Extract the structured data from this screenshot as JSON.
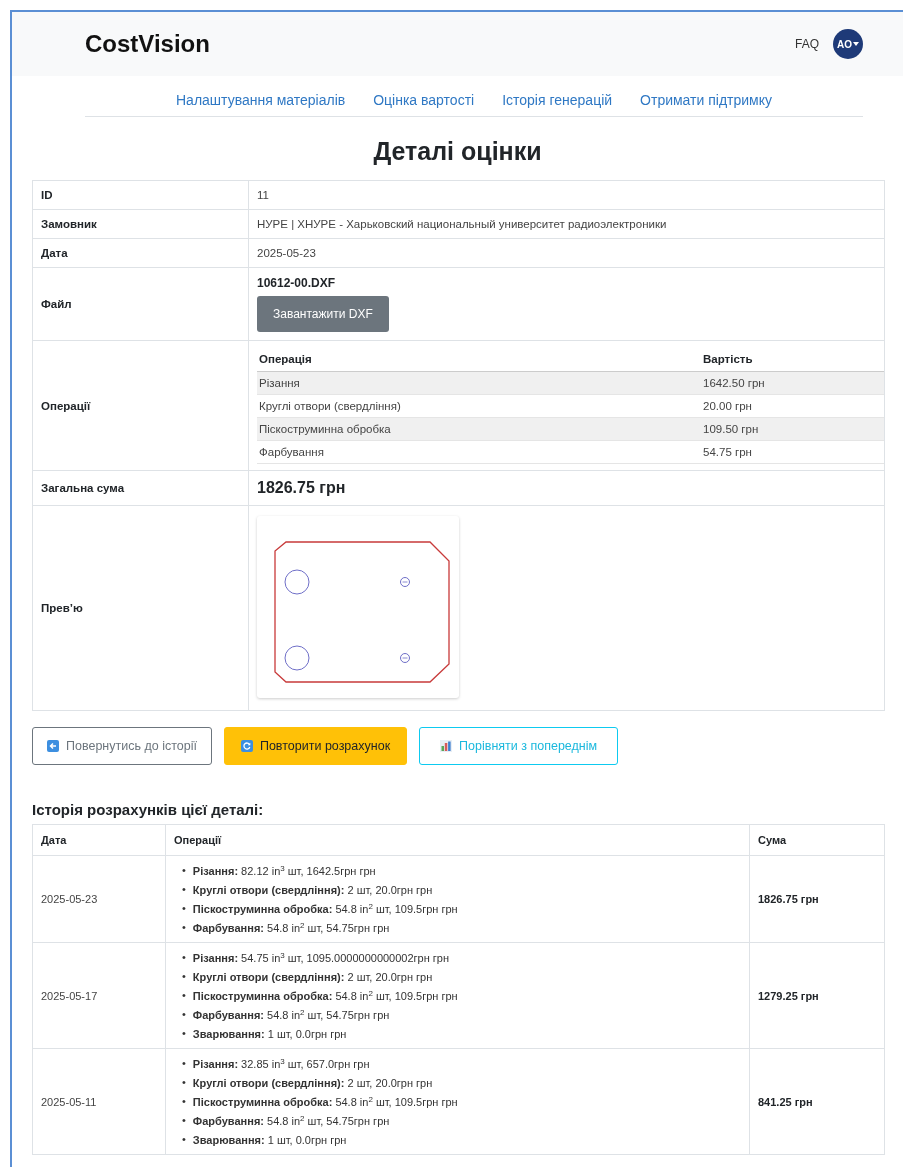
{
  "header": {
    "brand": "CostVision",
    "faq": "FAQ",
    "avatar": "AO"
  },
  "nav": [
    "Налаштування матеріалів",
    "Оцінка вартості",
    "Історія генерацій",
    "Отримати підтримку"
  ],
  "title": "Деталі оцінки",
  "details": {
    "id_label": "ID",
    "id": "11",
    "customer_label": "Замовник",
    "customer": "НУРЕ | ХНУРЕ - Харьковский национальный университет радиоэлектроники",
    "date_label": "Дата",
    "date": "2025-05-23",
    "file_label": "Файл",
    "file": "10612-00.DXF",
    "download": "Завантажити DXF",
    "ops_label": "Операції",
    "ops_columns": [
      "Операція",
      "Вартість"
    ],
    "ops": [
      [
        "Різання",
        "1642.50 грн"
      ],
      [
        "Круглі отвори (свердління)",
        "20.00 грн"
      ],
      [
        "Піскоструминна обробка",
        "109.50 грн"
      ],
      [
        "Фарбування",
        "54.75 грн"
      ]
    ],
    "total_label": "Загальна сума",
    "total": "1826.75 грн",
    "preview_label": "Прев’ю",
    "preview": {
      "kind": "picture"
    }
  },
  "actions": [
    {
      "label": "Повернутись до історії",
      "kind": "outline-secondary"
    },
    {
      "label": "Повторити розрахунок",
      "kind": "warning"
    },
    {
      "label": "Порівняти з попереднім",
      "kind": "outline-info"
    }
  ],
  "history": {
    "title": "Історія розрахунків цієї деталі:",
    "bullet": "•",
    "columns": [
      "Дата",
      "Операції",
      "Сума"
    ],
    "rows": [
      {
        "date": "2025-05-23",
        "sum": "1826.75 грн",
        "items": [
          "**Різання:** 82.12 in$^{3}$ шт, 1642.5грн грн",
          "**Круглі отвори (свердління):** 2 шт, 20.0грн грн",
          "**Піскоструминна обробка:** 54.8 in$^{2}$ шт, 109.5грн грн",
          "**Фарбування:** 54.8 in$^{2}$ шт, 54.75грн грн"
        ]
      },
      {
        "date": "2025-05-17",
        "sum": "1279.25 грн",
        "items": [
          "**Різання:** 54.75 in$^{3}$ шт, 1095.0000000000002грн грн",
          "**Круглі отвори (свердління):** 2 шт, 20.0грн грн",
          "**Піскоструминна обробка:** 54.8 in$^{2}$ шт, 109.5грн грн",
          "**Фарбування:** 54.8 in$^{2}$ шт, 54.75грн грн",
          "**Зварювання:** 1 шт, 0.0грн грн"
        ]
      },
      {
        "date": "2025-05-11",
        "sum": "841.25 грн",
        "items": [
          "**Різання:** 32.85 in$^{3}$ шт, 657.0грн грн",
          "**Круглі отвори (свердління):** 2 шт, 20.0грн грн",
          "**Піскоструминна обробка:** 54.8 in$^{2}$ шт, 109.5грн грн",
          "**Фарбування:** 54.8 in$^{2}$ шт, 54.75грн грн",
          "**Зварювання:** 1 шт, 0.0грн грн"
        ]
      }
    ]
  }
}
